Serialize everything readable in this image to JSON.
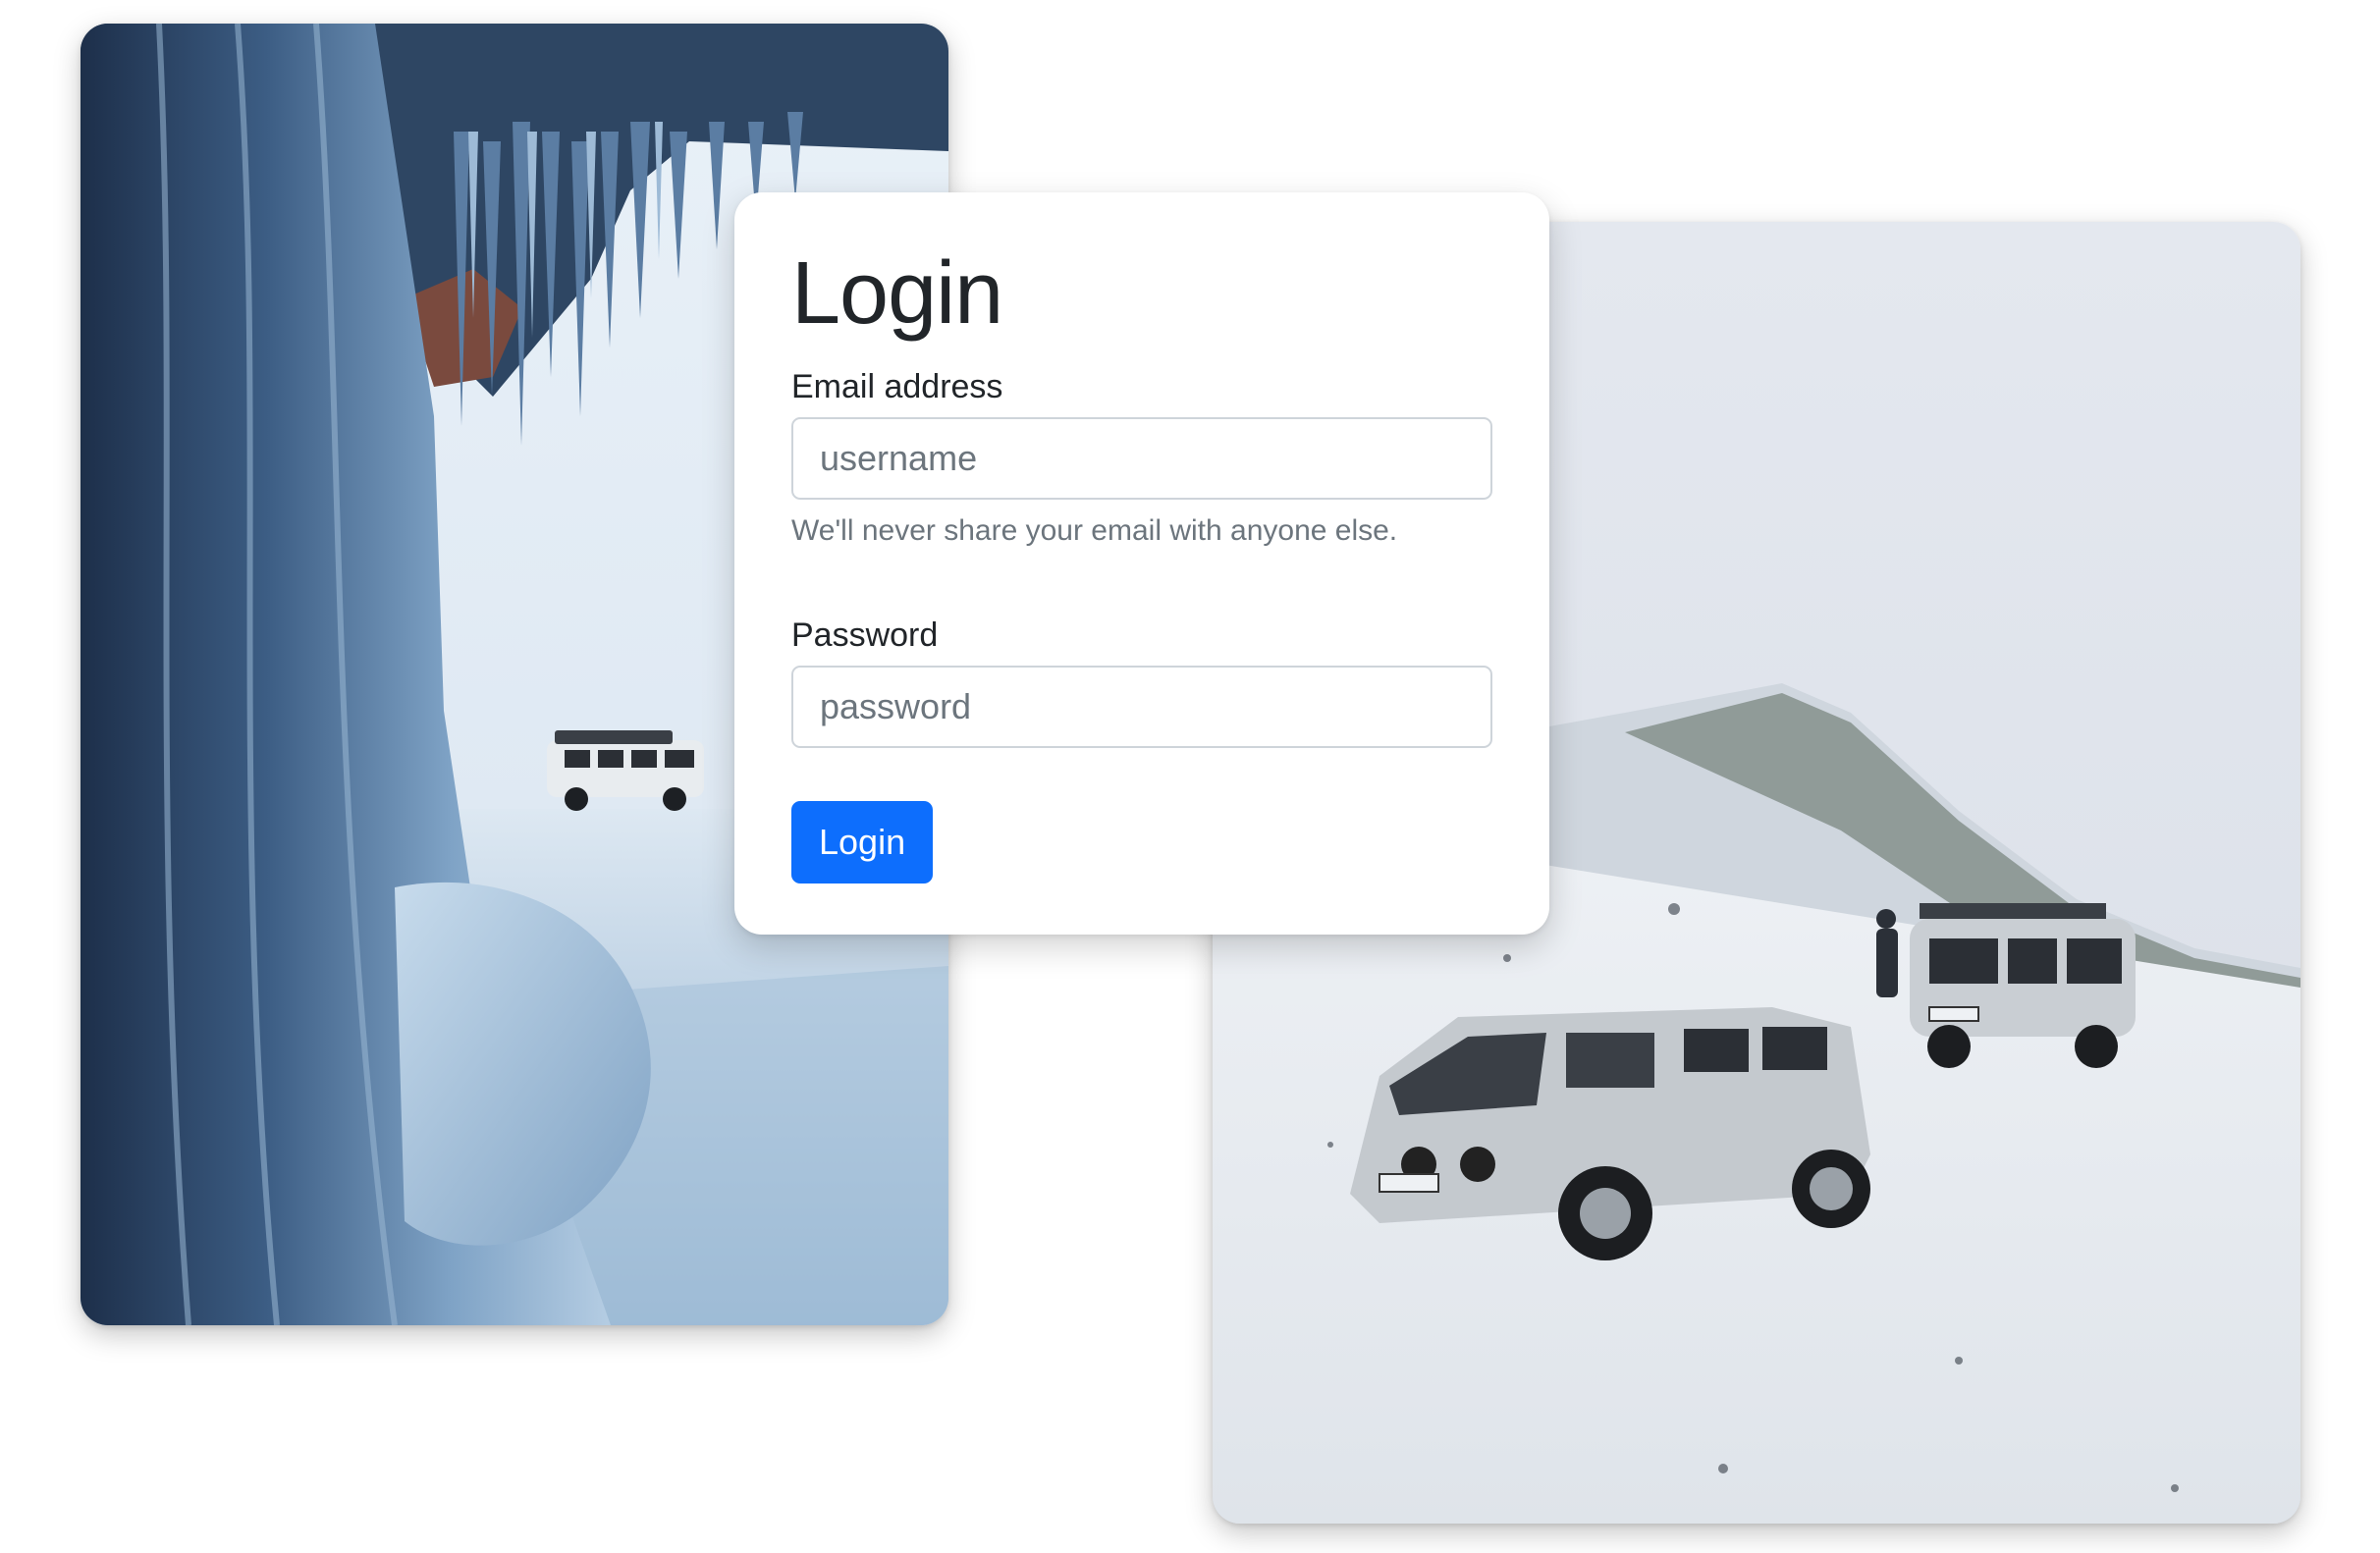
{
  "login": {
    "title": "Login",
    "email_label": "Email address",
    "email_placeholder": "username",
    "email_help": "We'll never share your email with anyone else.",
    "password_label": "Password",
    "password_placeholder": "password",
    "submit_label": "Login"
  },
  "colors": {
    "primary": "#0d6efd",
    "text": "#212529",
    "muted": "#6c757d",
    "input_border": "#ced4da"
  },
  "images": {
    "left": "ice-cave-with-van-photo",
    "right": "snowy-hill-with-vans-photo"
  }
}
